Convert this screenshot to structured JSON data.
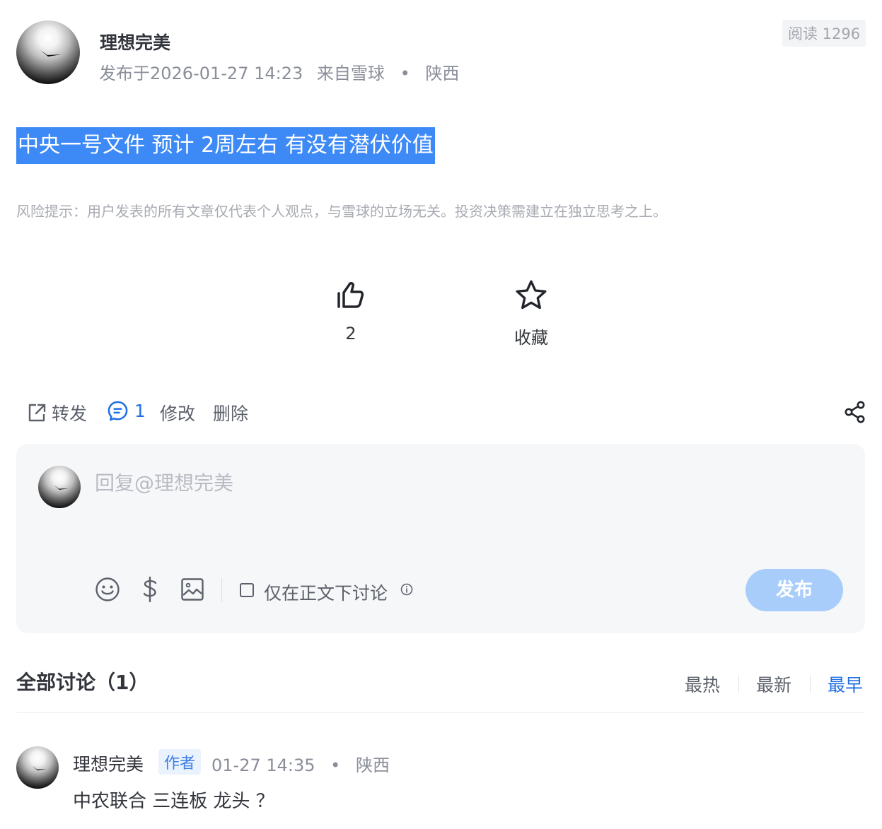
{
  "post": {
    "author": "理想完美",
    "published": "发布于2026-01-27 14:23",
    "source": "来自雪球",
    "location": "陕西",
    "read_count": "阅读 1296",
    "title": "中央一号文件 预计 2周左右 有没有潜伏价值",
    "risk_notice": "风险提示：用户发表的所有文章仅代表个人观点，与雪球的立场无关。投资决策需建立在独立思考之上。"
  },
  "actions": {
    "like_count": "2",
    "favorite_label": "收藏"
  },
  "toolbar": {
    "repost": "转发",
    "comment_count": "1",
    "edit": "修改",
    "delete": "删除"
  },
  "reply": {
    "placeholder": "回复@理想完美",
    "only_in_post": "仅在正文下讨论",
    "publish": "发布"
  },
  "discussion": {
    "title": "全部讨论（1）",
    "sort_hot": "最热",
    "sort_new": "最新",
    "sort_early": "最早",
    "comments": [
      {
        "author": "理想完美",
        "badge": "作者",
        "time": "01-27 14:35",
        "location": "陕西",
        "text": "中农联合 三连板 龙头 ？"
      }
    ]
  },
  "colors": {
    "accent": "#1f6fe6",
    "selection": "#3d8af7",
    "publish_disabled": "#a9cdfb"
  }
}
